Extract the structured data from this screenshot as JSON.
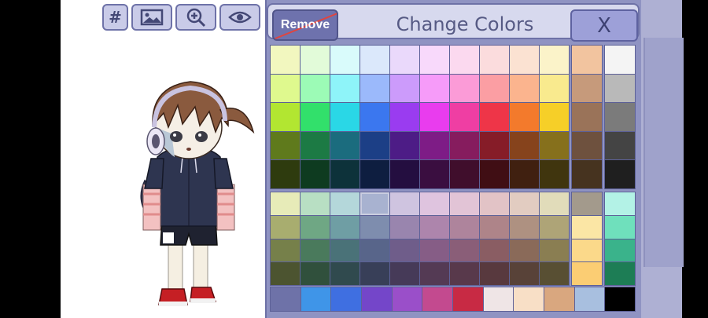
{
  "panel": {
    "title": "Change Colors",
    "remove_label": "Remove",
    "close_label": "X"
  },
  "toolbar": {
    "items": [
      {
        "name": "hash",
        "label": "#"
      },
      {
        "name": "image-icon"
      },
      {
        "name": "zoom-in-icon"
      },
      {
        "name": "eye-icon"
      }
    ]
  },
  "palette": {
    "upper_main": [
      [
        "#f2f7bf",
        "#e2fbd9",
        "#d9fbfb",
        "#dbe8fb",
        "#ead9fb",
        "#f8d9fb",
        "#fbd9ef",
        "#fbdcdd",
        "#fbe2d2",
        "#fbf3c9"
      ],
      [
        "#dff98e",
        "#9cfbb6",
        "#8ef4f9",
        "#9bb9fb",
        "#cc9bfb",
        "#f69bf9",
        "#fb9bd7",
        "#fb9ea3",
        "#fbb48e",
        "#f9ea8e"
      ],
      [
        "#b2e631",
        "#32e06b",
        "#2ad7e6",
        "#3b77ef",
        "#9a3cf0",
        "#e93cee",
        "#ef3ea3",
        "#ee3548",
        "#f37a2c",
        "#f6cf28"
      ],
      [
        "#5f7a1c",
        "#1c7a44",
        "#1b6c7e",
        "#1c3f86",
        "#4d1c86",
        "#7e1c86",
        "#861c5e",
        "#861c28",
        "#86431c",
        "#86701c"
      ],
      [
        "#2e3b0e",
        "#0e3b20",
        "#0d323a",
        "#0e1e40",
        "#240e40",
        "#3a0e40",
        "#400e2c",
        "#400e14",
        "#402010",
        "#40350e"
      ]
    ],
    "upper_skin": [
      "#f2c49f",
      "#c69a7b",
      "#9a7359",
      "#6e513e",
      "#46331f"
    ],
    "upper_gray": [
      "#f4f4f4",
      "#b9b9b9",
      "#7b7b7b",
      "#444444",
      "#1f1f1f"
    ],
    "lower_main": [
      [
        "#e7ebb8",
        "#b8dfc3",
        "#b4d7da",
        "#c2cde3",
        "#cfc4e0",
        "#dfc4df",
        "#e2c4d6",
        "#e2c3c6",
        "#e2ccc1",
        "#e1dcba"
      ],
      [
        "#a8ad6f",
        "#6fa784",
        "#6f9ea4",
        "#7e8dae",
        "#9985ae",
        "#ad85ac",
        "#ae849c",
        "#ae8489",
        "#ae9181",
        "#aea477"
      ],
      [
        "#76804a",
        "#4a7a5c",
        "#4a7278",
        "#58658a",
        "#6f5d8a",
        "#865d86",
        "#8a5e78",
        "#8a5d63",
        "#8a6a59",
        "#8a7e52"
      ],
      [
        "#4c5430",
        "#30503c",
        "#304a4e",
        "#383f58",
        "#463a58",
        "#543a54",
        "#58394b",
        "#58393e",
        "#584238",
        "#584f33"
      ]
    ],
    "lower_selected": {
      "row": 0,
      "col": 3
    },
    "lower_skin": [
      "#a39a8c",
      "#fbe6a5",
      "#fbd98a",
      "#fbcd73"
    ],
    "lower_teal": [
      "#b3f2e6",
      "#6fe0bc",
      "#3ab38b",
      "#1d7d55"
    ],
    "bottom_row": [
      "#6e72a8",
      "#3f95e8",
      "#3f6fe1",
      "#7446c9",
      "#9a4fc9",
      "#c34a8f",
      "#c82a44",
      "#efe5e6",
      "#f8dfc6",
      "#d9a77f",
      "#a8bfdf",
      "#000000"
    ]
  }
}
